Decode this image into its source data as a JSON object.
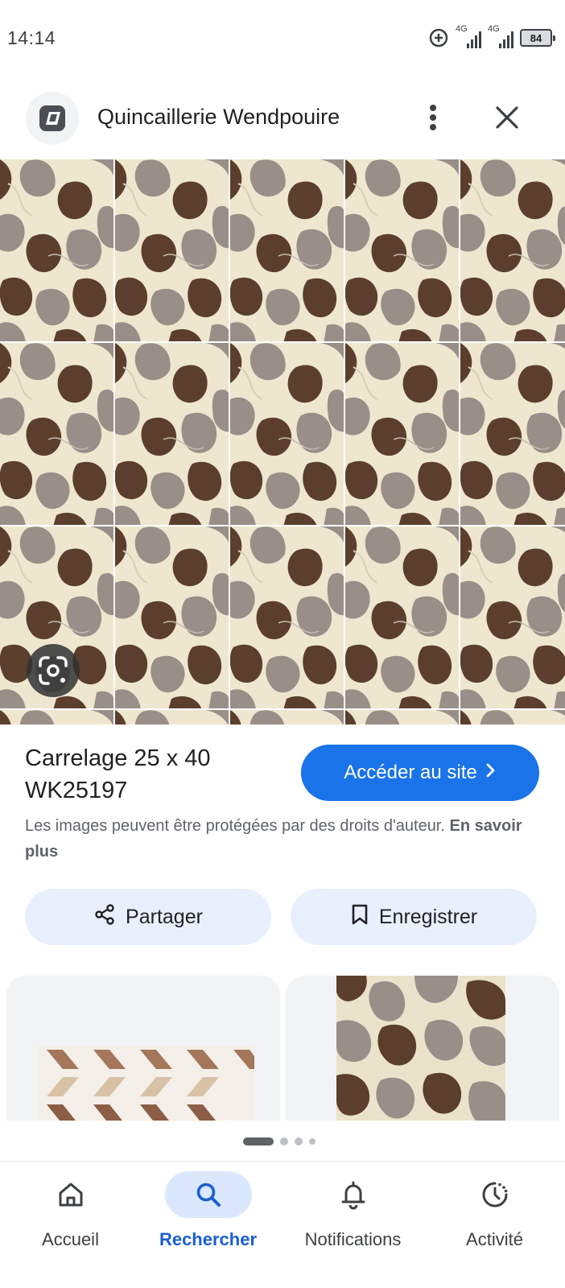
{
  "status_bar": {
    "time": "14:14",
    "network_1": "4G",
    "network_2": "4G",
    "battery": "84",
    "icons": [
      "data-saver-icon",
      "signal-icon",
      "signal-icon",
      "battery-icon"
    ]
  },
  "header": {
    "site_name": "Quincaillerie Wendpouire",
    "logo_icon": "site-logo-icon",
    "more_icon": "more-vert-icon",
    "close_icon": "close-icon"
  },
  "image": {
    "lens_icon": "google-lens-icon",
    "colors": {
      "cream": "#efe6cf",
      "taupe": "#9a8e89",
      "brown": "#5b3f2c"
    }
  },
  "details": {
    "title": "Carrelage 25 x 40 WK25197",
    "visit_label": "Accéder au site",
    "copyright_text": "Les images peuvent être protégées par des droits d'auteur.",
    "learn_more": "En savoir plus"
  },
  "actions": {
    "share_label": "Partager",
    "save_label": "Enregistrer"
  },
  "pager": {
    "pages": 4,
    "current": 1
  },
  "bottom_nav": {
    "items": [
      {
        "label": "Accueil",
        "icon": "home-icon"
      },
      {
        "label": "Rechercher",
        "icon": "search-icon"
      },
      {
        "label": "Notifications",
        "icon": "bell-icon"
      },
      {
        "label": "Activité",
        "icon": "activity-icon"
      }
    ],
    "active": "Rechercher"
  },
  "colors": {
    "accent": "#1a73e8",
    "pill_bg": "#e8f0fe",
    "active_nav_bg": "#dbe7fd"
  }
}
